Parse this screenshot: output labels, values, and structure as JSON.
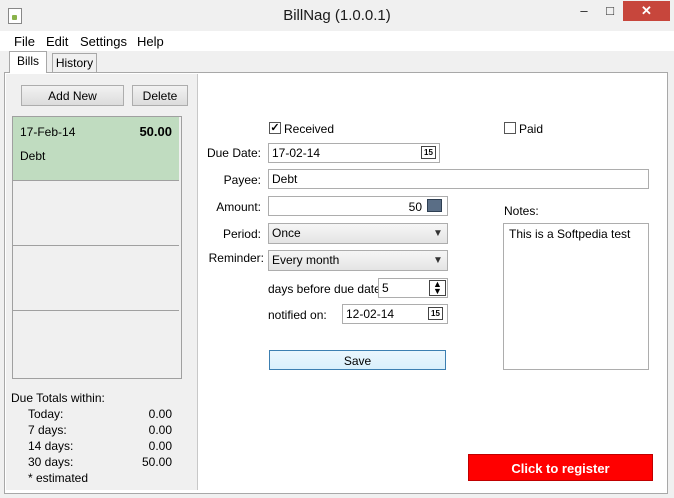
{
  "window": {
    "title": "BillNag (1.0.0.1)",
    "min": "–",
    "max": "□",
    "close": "✕"
  },
  "menu": [
    "File",
    "Edit",
    "Settings",
    "Help"
  ],
  "tabs": [
    "Bills",
    "History"
  ],
  "buttons": {
    "add_new": "Add New",
    "delete": "Delete",
    "save": "Save",
    "register": "Click to register"
  },
  "bills": [
    {
      "date": "17-Feb-14",
      "amount": "50.00",
      "name": "Debt"
    }
  ],
  "totals": {
    "heading": "Due Totals within:",
    "rows": [
      {
        "label": "Today:",
        "value": "0.00"
      },
      {
        "label": "7 days:",
        "value": "0.00"
      },
      {
        "label": "14 days:",
        "value": "0.00"
      },
      {
        "label": "30 days:",
        "value": "50.00"
      }
    ],
    "note": "* estimated"
  },
  "form": {
    "received_label": "Received",
    "received_checked": true,
    "paid_label": "Paid",
    "paid_checked": false,
    "due_date_label": "Due Date:",
    "due_date": "17-02-14",
    "payee_label": "Payee:",
    "payee": "Debt",
    "amount_label": "Amount:",
    "amount": "50",
    "period_label": "Period:",
    "period": "Once",
    "reminder_label": "Reminder:",
    "reminder": "Every month",
    "days_before_label": "days before due date:",
    "days_before": "5",
    "notified_label": "notified on:",
    "notified_on": "12-02-14",
    "notes_label": "Notes:",
    "notes": "This is a Softpedia test",
    "calendar_glyph": "15"
  }
}
